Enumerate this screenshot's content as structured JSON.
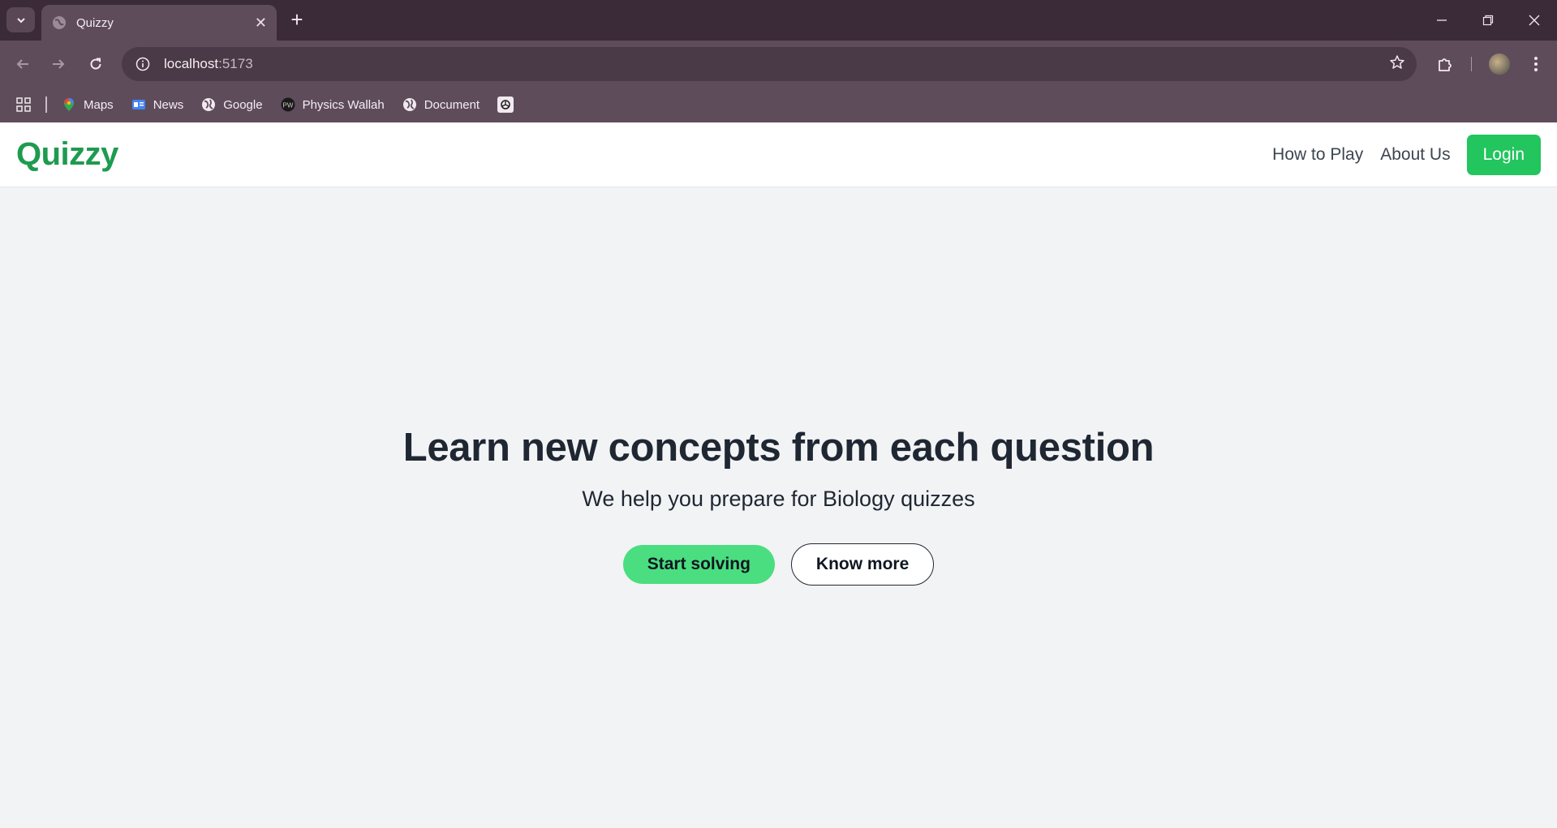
{
  "browser": {
    "tab_title": "Quizzy",
    "url_host": "localhost",
    "url_port": ":5173",
    "bookmarks": [
      {
        "label": "Maps",
        "icon": "maps-icon"
      },
      {
        "label": "News",
        "icon": "news-icon"
      },
      {
        "label": "Google",
        "icon": "globe-icon"
      },
      {
        "label": "Physics Wallah",
        "icon": "pw-icon"
      },
      {
        "label": "Document",
        "icon": "globe-icon"
      }
    ]
  },
  "site": {
    "logo": "Quizzy",
    "nav": {
      "how_to_play": "How to Play",
      "about_us": "About Us",
      "login": "Login"
    },
    "hero": {
      "title": "Learn new concepts from each question",
      "subtitle": "We help you prepare for Biology quizzes",
      "primary_cta": "Start solving",
      "secondary_cta": "Know more"
    }
  },
  "colors": {
    "brand_green": "#1e9b4f",
    "login_green": "#22c55e",
    "cta_green": "#4ade80",
    "browser_frame": "#5f4c5b"
  }
}
